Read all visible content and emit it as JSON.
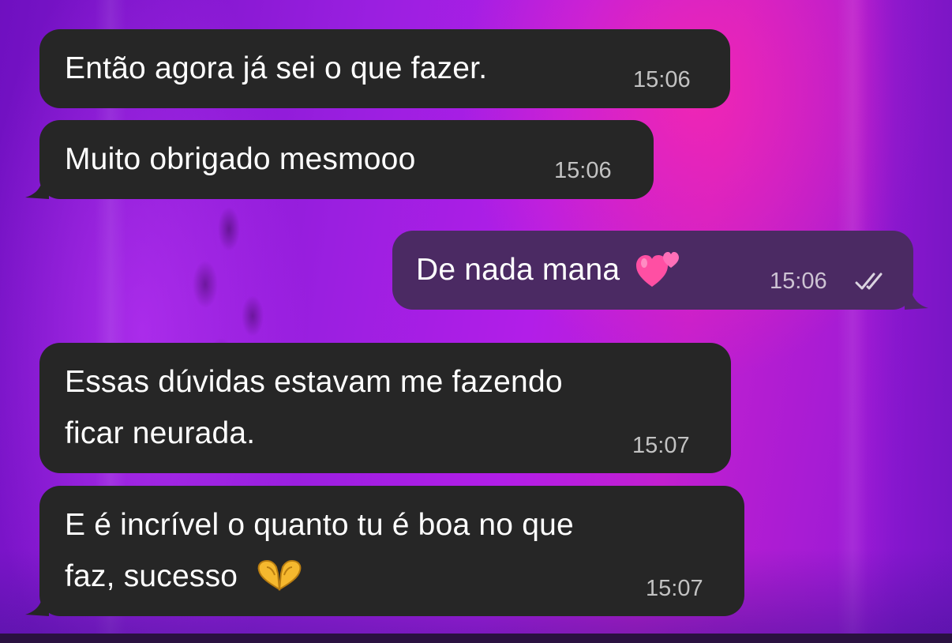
{
  "chat": {
    "messages": [
      {
        "direction": "incoming",
        "text": "Então agora já sei o que fazer.",
        "time": "15:06"
      },
      {
        "direction": "incoming",
        "text": "Muito obrigado mesmooo",
        "time": "15:06"
      },
      {
        "direction": "outgoing",
        "text": "De nada mana",
        "emoji": "two-hearts-emoji",
        "time": "15:06",
        "status": "read-double-check"
      },
      {
        "direction": "incoming",
        "line1": "Essas dúvidas estavam me fazendo",
        "line2": "ficar neurada.",
        "time": "15:07"
      },
      {
        "direction": "incoming",
        "line1": "E é incrível o quanto tu é boa no que",
        "line2": "faz, sucesso",
        "emoji": "heart-hands-emoji",
        "time": "15:07"
      }
    ]
  },
  "colors": {
    "incoming_bubble": "#262626",
    "outgoing_bubble": "#4b2a63",
    "wallpaper_accent": "#b21ee8",
    "heart_emoji": "#ff4fa3",
    "hands_emoji": "#f5b82e"
  }
}
